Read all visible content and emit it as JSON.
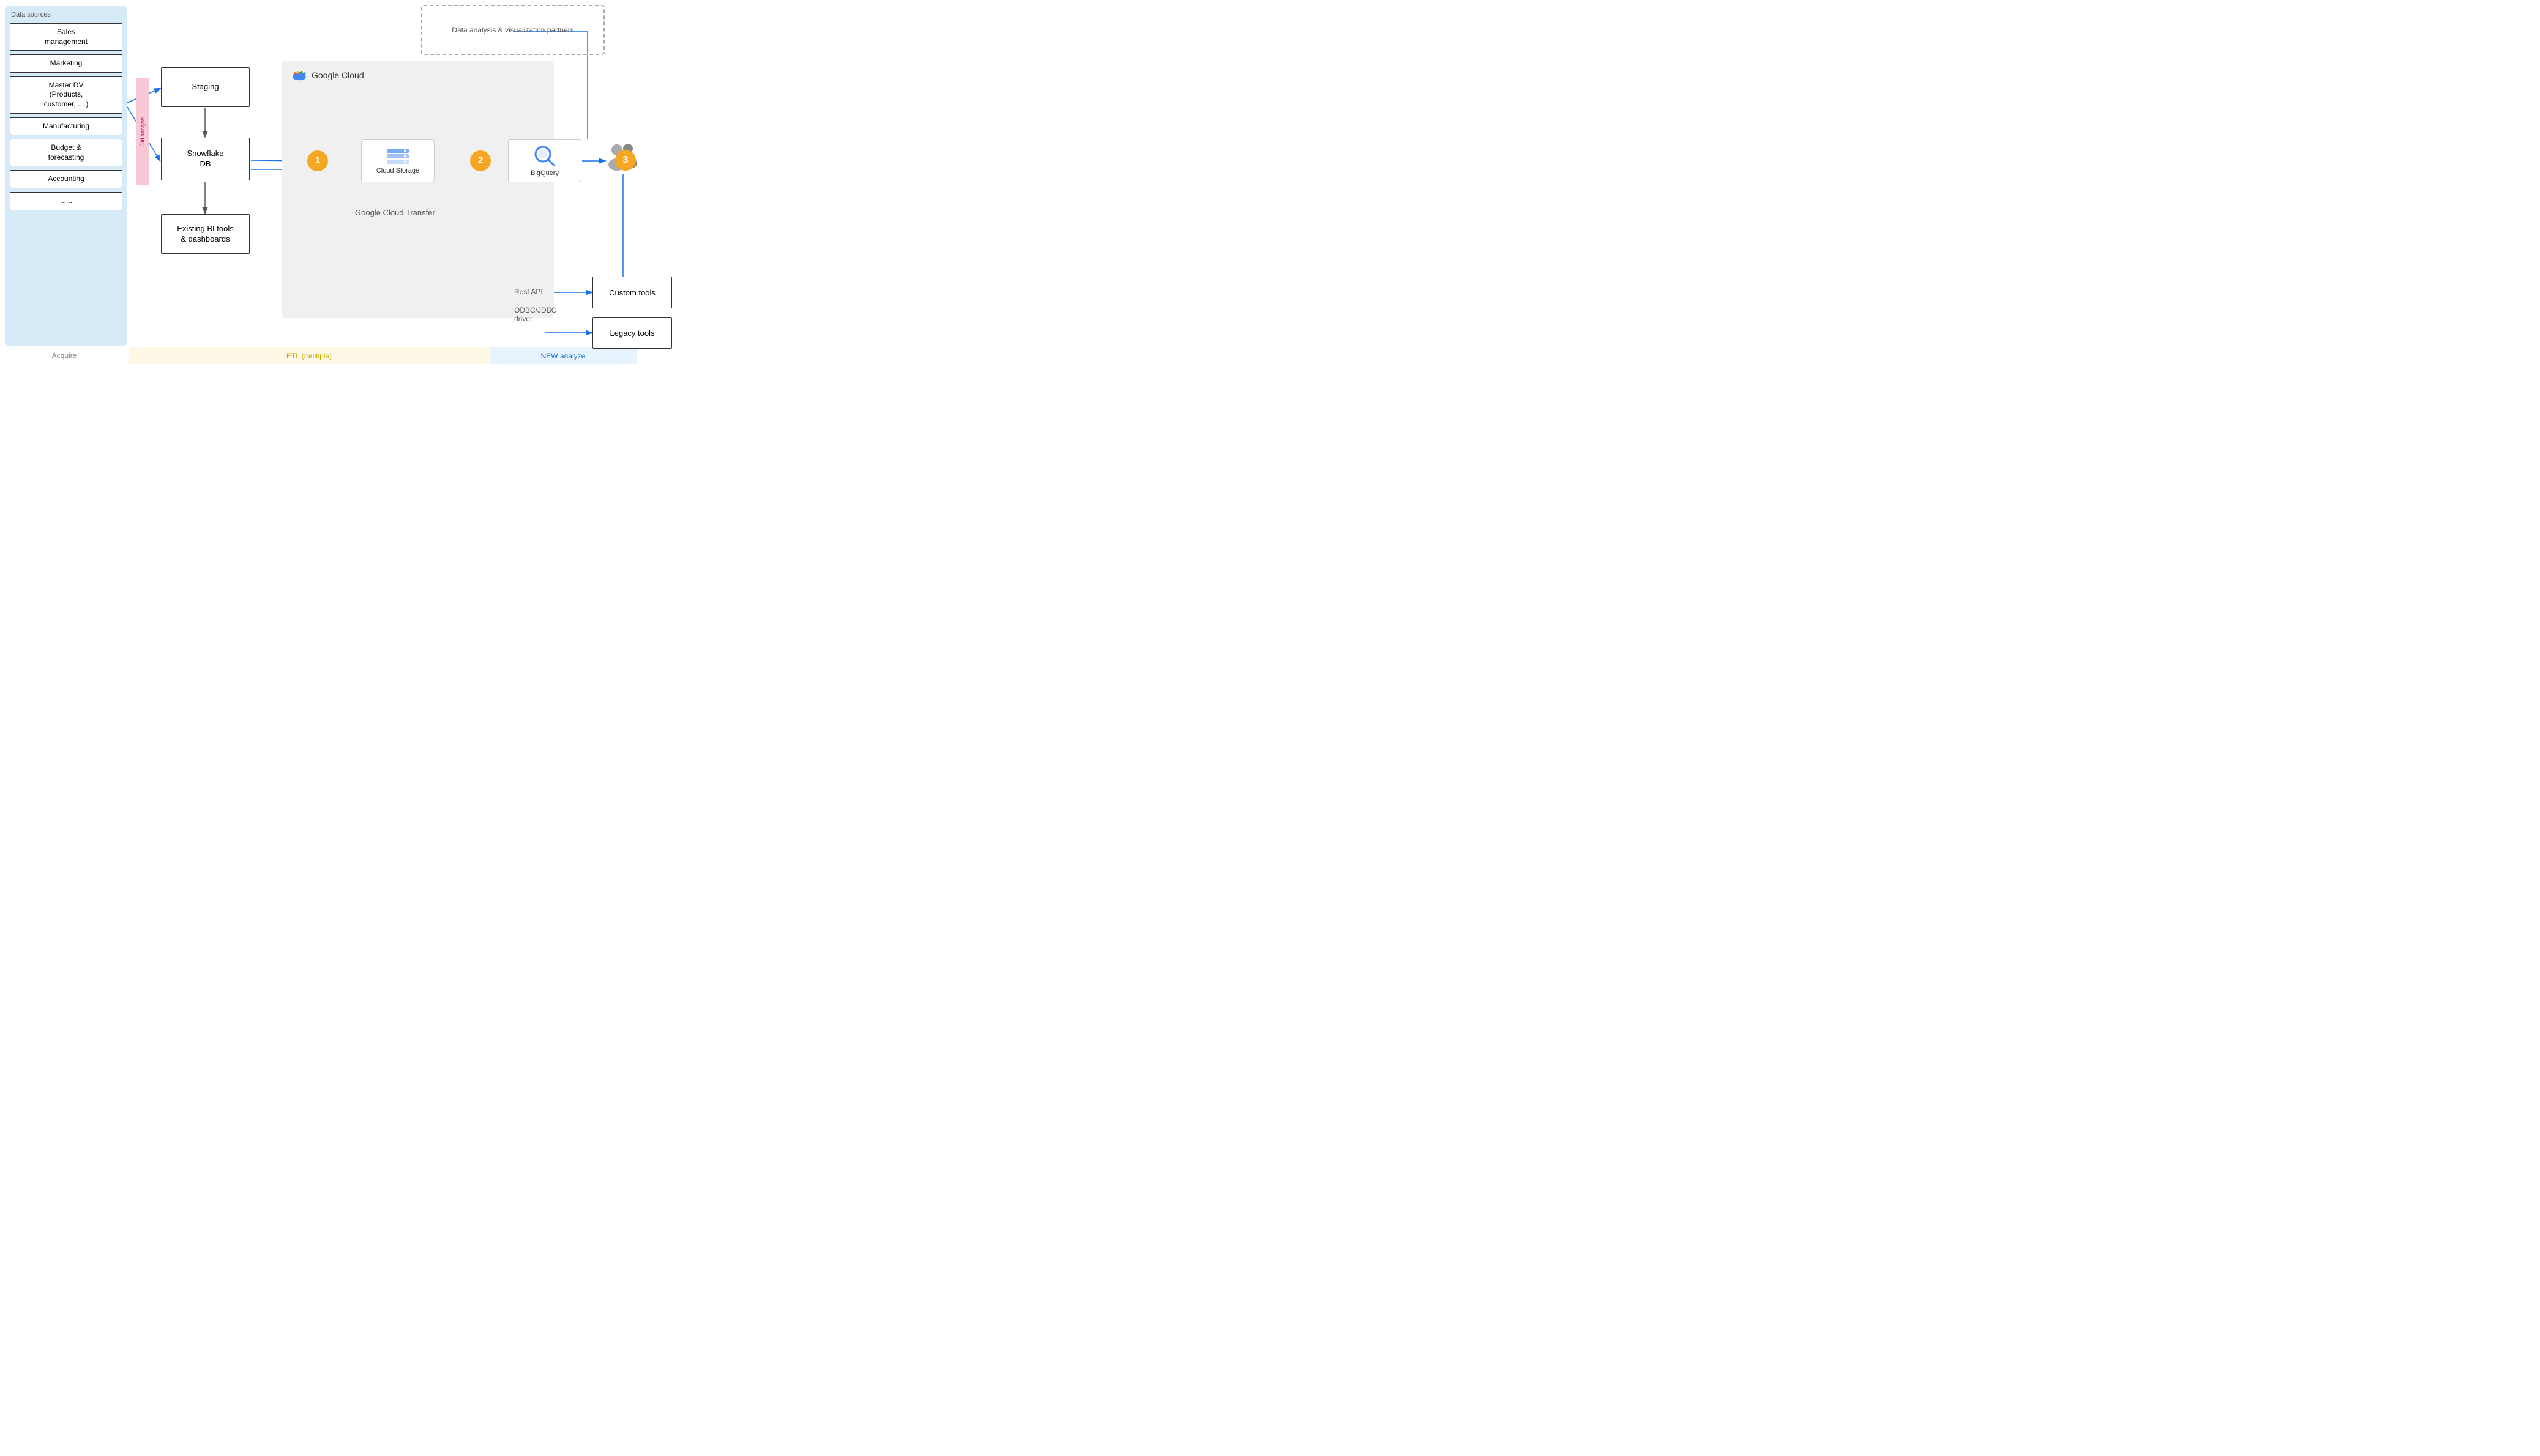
{
  "phases": {
    "acquire": "Acquire",
    "etl": "ETL (multiple)",
    "analyze": "NEW analyze"
  },
  "datasources": {
    "panel_label": "Data sources",
    "items": [
      {
        "label": "Sales\nmanagement"
      },
      {
        "label": "Marketing"
      },
      {
        "label": "Master DV\n(Products,\ncustomer, ....)"
      },
      {
        "label": "Manufacturing"
      },
      {
        "label": "Budget &\nforecasting"
      },
      {
        "label": "Accounting"
      },
      {
        "label": "......"
      }
    ]
  },
  "old_analyse": "Old analyse",
  "etl_boxes": {
    "staging": "Staging",
    "snowflake": "Snowflake\nDB",
    "bitools": "Existing BI tools\n& dashboards"
  },
  "gc": {
    "logo_text": "Google Cloud",
    "transfer_label": "Google Cloud Transfer"
  },
  "cloud_storage": {
    "label": "Cloud Storage"
  },
  "bigquery": {
    "label": "BigQuery"
  },
  "numbers": {
    "n1": "1",
    "n2": "2",
    "n3": "3"
  },
  "dap": {
    "label": "Data analysis & visualization partners"
  },
  "api_labels": {
    "rest": "Rest API",
    "odbc": "ODBC/JDBC\ndriver"
  },
  "tools": {
    "custom": "Custom tools",
    "legacy": "Legacy tools"
  }
}
